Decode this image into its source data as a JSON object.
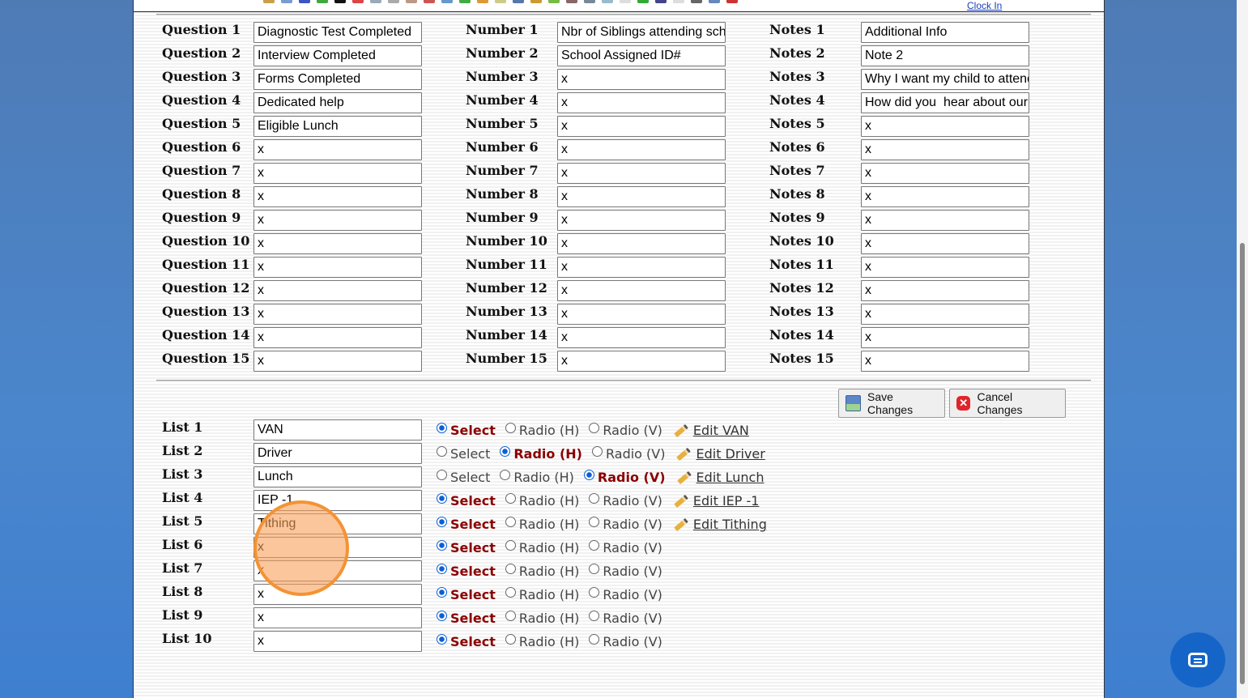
{
  "header": {
    "clock_in": "Clock In"
  },
  "questions": [
    "Diagnostic Test Completed",
    "Interview Completed",
    "Forms Completed",
    "Dedicated help",
    "Eligible Lunch",
    "x",
    "x",
    "x",
    "x",
    "x",
    "x",
    "x",
    "x",
    "x",
    "x"
  ],
  "question_labels": [
    "Question 1",
    "Question 2",
    "Question 3",
    "Question 4",
    "Question 5",
    "Question 6",
    "Question 7",
    "Question 8",
    "Question 9",
    "Question 10",
    "Question 11",
    "Question 12",
    "Question 13",
    "Question 14",
    "Question 15"
  ],
  "numbers": [
    "Nbr of Siblings attending school",
    "School Assigned ID#",
    "x",
    "x",
    "x",
    "x",
    "x",
    "x",
    "x",
    "x",
    "x",
    "x",
    "x",
    "x",
    "x"
  ],
  "number_labels": [
    "Number 1",
    "Number 2",
    "Number 3",
    "Number 4",
    "Number 5",
    "Number 6",
    "Number 7",
    "Number 8",
    "Number 9",
    "Number 10",
    "Number 11",
    "Number 12",
    "Number 13",
    "Number 14",
    "Number 15"
  ],
  "notes": [
    "Additional Info",
    "Note 2",
    "Why I want my child to attend",
    "How did you  hear about our school",
    "x",
    "x",
    "x",
    "x",
    "x",
    "x",
    "x",
    "x",
    "x",
    "x",
    "x"
  ],
  "notes_labels": [
    "Notes 1",
    "Notes 2",
    "Notes 3",
    "Notes 4",
    "Notes 5",
    "Notes 6",
    "Notes 7",
    "Notes 8",
    "Notes 9",
    "Notes 10",
    "Notes 11",
    "Notes 12",
    "Notes 13",
    "Notes 14",
    "Notes 15"
  ],
  "buttons": {
    "save": "Save Changes",
    "cancel": "Cancel Changes"
  },
  "option_labels": {
    "select": "Select",
    "radio_h": "Radio (H)",
    "radio_v": "Radio (V)"
  },
  "lists": [
    {
      "label": "List 1",
      "value": "VAN",
      "mode": "select",
      "edit": "Edit VAN"
    },
    {
      "label": "List 2",
      "value": "Driver",
      "mode": "radio_h",
      "edit": "Edit Driver"
    },
    {
      "label": "List 3",
      "value": "Lunch",
      "mode": "radio_v",
      "edit": "Edit Lunch"
    },
    {
      "label": "List 4",
      "value": "IEP -1",
      "mode": "select",
      "edit": "Edit IEP -1"
    },
    {
      "label": "List 5",
      "value": "Tithing",
      "mode": "select",
      "edit": "Edit Tithing"
    },
    {
      "label": "List 6",
      "value": "x",
      "mode": "select",
      "edit": null
    },
    {
      "label": "List 7",
      "value": "x",
      "mode": "select",
      "edit": null
    },
    {
      "label": "List 8",
      "value": "x",
      "mode": "select",
      "edit": null
    },
    {
      "label": "List 9",
      "value": "x",
      "mode": "select",
      "edit": null
    },
    {
      "label": "List 10",
      "value": "x",
      "mode": "select",
      "edit": null
    }
  ]
}
